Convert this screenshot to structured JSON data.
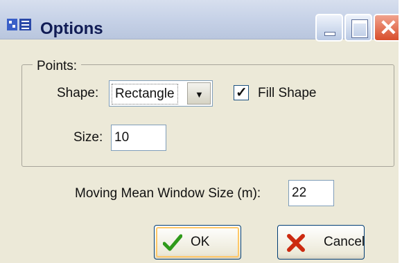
{
  "window": {
    "title": "Options"
  },
  "points_group": {
    "legend": "Points:",
    "shape_label": "Shape:",
    "shape_value": "Rectangle",
    "fill_shape_label": "Fill Shape",
    "fill_shape_checked": true,
    "size_label": "Size:",
    "size_value": "10"
  },
  "moving_mean": {
    "label": "Moving Mean Window Size (m):",
    "value": "22"
  },
  "buttons": {
    "ok_label": "OK",
    "cancel_label": "Cancel"
  },
  "icons": {
    "app": "app-icon",
    "minimize": "minimize-icon",
    "maximize": "maximize-icon",
    "close": "close-icon",
    "dropdown": "chevron-down-icon",
    "checkmark": "checkmark-icon",
    "ok": "green-check-icon",
    "cancel": "red-x-icon"
  },
  "colors": {
    "window_bg": "#ece9d8",
    "titlebar": "#c8d3e8",
    "title_text": "#111c55",
    "close_button": "#d84e2b",
    "ok_icon": "#2f9a1a",
    "cancel_icon": "#cc2a10"
  }
}
